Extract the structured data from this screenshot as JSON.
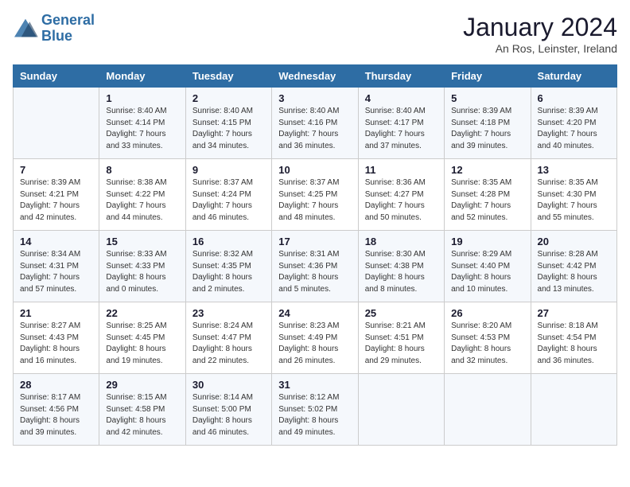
{
  "logo": {
    "line1": "General",
    "line2": "Blue"
  },
  "title": "January 2024",
  "subtitle": "An Ros, Leinster, Ireland",
  "days_of_week": [
    "Sunday",
    "Monday",
    "Tuesday",
    "Wednesday",
    "Thursday",
    "Friday",
    "Saturday"
  ],
  "weeks": [
    [
      {
        "day": "",
        "sunrise": "",
        "sunset": "",
        "daylight": ""
      },
      {
        "day": "1",
        "sunrise": "Sunrise: 8:40 AM",
        "sunset": "Sunset: 4:14 PM",
        "daylight": "Daylight: 7 hours and 33 minutes."
      },
      {
        "day": "2",
        "sunrise": "Sunrise: 8:40 AM",
        "sunset": "Sunset: 4:15 PM",
        "daylight": "Daylight: 7 hours and 34 minutes."
      },
      {
        "day": "3",
        "sunrise": "Sunrise: 8:40 AM",
        "sunset": "Sunset: 4:16 PM",
        "daylight": "Daylight: 7 hours and 36 minutes."
      },
      {
        "day": "4",
        "sunrise": "Sunrise: 8:40 AM",
        "sunset": "Sunset: 4:17 PM",
        "daylight": "Daylight: 7 hours and 37 minutes."
      },
      {
        "day": "5",
        "sunrise": "Sunrise: 8:39 AM",
        "sunset": "Sunset: 4:18 PM",
        "daylight": "Daylight: 7 hours and 39 minutes."
      },
      {
        "day": "6",
        "sunrise": "Sunrise: 8:39 AM",
        "sunset": "Sunset: 4:20 PM",
        "daylight": "Daylight: 7 hours and 40 minutes."
      }
    ],
    [
      {
        "day": "7",
        "sunrise": "Sunrise: 8:39 AM",
        "sunset": "Sunset: 4:21 PM",
        "daylight": "Daylight: 7 hours and 42 minutes."
      },
      {
        "day": "8",
        "sunrise": "Sunrise: 8:38 AM",
        "sunset": "Sunset: 4:22 PM",
        "daylight": "Daylight: 7 hours and 44 minutes."
      },
      {
        "day": "9",
        "sunrise": "Sunrise: 8:37 AM",
        "sunset": "Sunset: 4:24 PM",
        "daylight": "Daylight: 7 hours and 46 minutes."
      },
      {
        "day": "10",
        "sunrise": "Sunrise: 8:37 AM",
        "sunset": "Sunset: 4:25 PM",
        "daylight": "Daylight: 7 hours and 48 minutes."
      },
      {
        "day": "11",
        "sunrise": "Sunrise: 8:36 AM",
        "sunset": "Sunset: 4:27 PM",
        "daylight": "Daylight: 7 hours and 50 minutes."
      },
      {
        "day": "12",
        "sunrise": "Sunrise: 8:35 AM",
        "sunset": "Sunset: 4:28 PM",
        "daylight": "Daylight: 7 hours and 52 minutes."
      },
      {
        "day": "13",
        "sunrise": "Sunrise: 8:35 AM",
        "sunset": "Sunset: 4:30 PM",
        "daylight": "Daylight: 7 hours and 55 minutes."
      }
    ],
    [
      {
        "day": "14",
        "sunrise": "Sunrise: 8:34 AM",
        "sunset": "Sunset: 4:31 PM",
        "daylight": "Daylight: 7 hours and 57 minutes."
      },
      {
        "day": "15",
        "sunrise": "Sunrise: 8:33 AM",
        "sunset": "Sunset: 4:33 PM",
        "daylight": "Daylight: 8 hours and 0 minutes."
      },
      {
        "day": "16",
        "sunrise": "Sunrise: 8:32 AM",
        "sunset": "Sunset: 4:35 PM",
        "daylight": "Daylight: 8 hours and 2 minutes."
      },
      {
        "day": "17",
        "sunrise": "Sunrise: 8:31 AM",
        "sunset": "Sunset: 4:36 PM",
        "daylight": "Daylight: 8 hours and 5 minutes."
      },
      {
        "day": "18",
        "sunrise": "Sunrise: 8:30 AM",
        "sunset": "Sunset: 4:38 PM",
        "daylight": "Daylight: 8 hours and 8 minutes."
      },
      {
        "day": "19",
        "sunrise": "Sunrise: 8:29 AM",
        "sunset": "Sunset: 4:40 PM",
        "daylight": "Daylight: 8 hours and 10 minutes."
      },
      {
        "day": "20",
        "sunrise": "Sunrise: 8:28 AM",
        "sunset": "Sunset: 4:42 PM",
        "daylight": "Daylight: 8 hours and 13 minutes."
      }
    ],
    [
      {
        "day": "21",
        "sunrise": "Sunrise: 8:27 AM",
        "sunset": "Sunset: 4:43 PM",
        "daylight": "Daylight: 8 hours and 16 minutes."
      },
      {
        "day": "22",
        "sunrise": "Sunrise: 8:25 AM",
        "sunset": "Sunset: 4:45 PM",
        "daylight": "Daylight: 8 hours and 19 minutes."
      },
      {
        "day": "23",
        "sunrise": "Sunrise: 8:24 AM",
        "sunset": "Sunset: 4:47 PM",
        "daylight": "Daylight: 8 hours and 22 minutes."
      },
      {
        "day": "24",
        "sunrise": "Sunrise: 8:23 AM",
        "sunset": "Sunset: 4:49 PM",
        "daylight": "Daylight: 8 hours and 26 minutes."
      },
      {
        "day": "25",
        "sunrise": "Sunrise: 8:21 AM",
        "sunset": "Sunset: 4:51 PM",
        "daylight": "Daylight: 8 hours and 29 minutes."
      },
      {
        "day": "26",
        "sunrise": "Sunrise: 8:20 AM",
        "sunset": "Sunset: 4:53 PM",
        "daylight": "Daylight: 8 hours and 32 minutes."
      },
      {
        "day": "27",
        "sunrise": "Sunrise: 8:18 AM",
        "sunset": "Sunset: 4:54 PM",
        "daylight": "Daylight: 8 hours and 36 minutes."
      }
    ],
    [
      {
        "day": "28",
        "sunrise": "Sunrise: 8:17 AM",
        "sunset": "Sunset: 4:56 PM",
        "daylight": "Daylight: 8 hours and 39 minutes."
      },
      {
        "day": "29",
        "sunrise": "Sunrise: 8:15 AM",
        "sunset": "Sunset: 4:58 PM",
        "daylight": "Daylight: 8 hours and 42 minutes."
      },
      {
        "day": "30",
        "sunrise": "Sunrise: 8:14 AM",
        "sunset": "Sunset: 5:00 PM",
        "daylight": "Daylight: 8 hours and 46 minutes."
      },
      {
        "day": "31",
        "sunrise": "Sunrise: 8:12 AM",
        "sunset": "Sunset: 5:02 PM",
        "daylight": "Daylight: 8 hours and 49 minutes."
      },
      {
        "day": "",
        "sunrise": "",
        "sunset": "",
        "daylight": ""
      },
      {
        "day": "",
        "sunrise": "",
        "sunset": "",
        "daylight": ""
      },
      {
        "day": "",
        "sunrise": "",
        "sunset": "",
        "daylight": ""
      }
    ]
  ]
}
